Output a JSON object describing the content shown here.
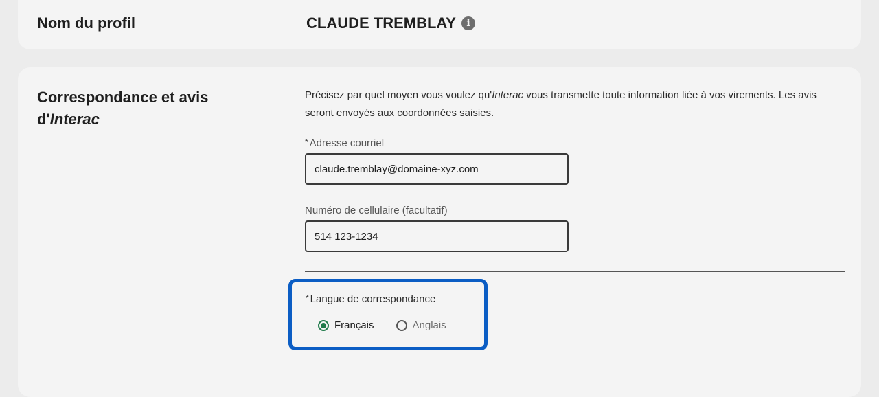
{
  "profile": {
    "label": "Nom du profil",
    "name": "CLAUDE TREMBLAY",
    "info_icon": "info-icon"
  },
  "correspondence": {
    "title_line1": "Correspondance et avis",
    "title_prefix": "d'",
    "title_italic": "Interac",
    "intro_part1": "Précisez par quel moyen vous voulez qu'",
    "intro_italic": "Interac",
    "intro_part2": " vous transmette toute information liée à vos virements. Les avis seront envoyés aux coordonnées saisies.",
    "email": {
      "required_mark": "*",
      "label": "Adresse courriel",
      "value": "claude.tremblay@domaine-xyz.com"
    },
    "phone": {
      "label": "Numéro de cellulaire (facultatif)",
      "value": "514 123-1234"
    },
    "language": {
      "required_mark": "*",
      "label": "Langue de correspondance",
      "options": [
        {
          "label": "Français",
          "selected": true
        },
        {
          "label": "Anglais",
          "selected": false
        }
      ]
    }
  },
  "colors": {
    "highlight_border": "#0b5dc4",
    "radio_selected": "#1f7a4a"
  }
}
